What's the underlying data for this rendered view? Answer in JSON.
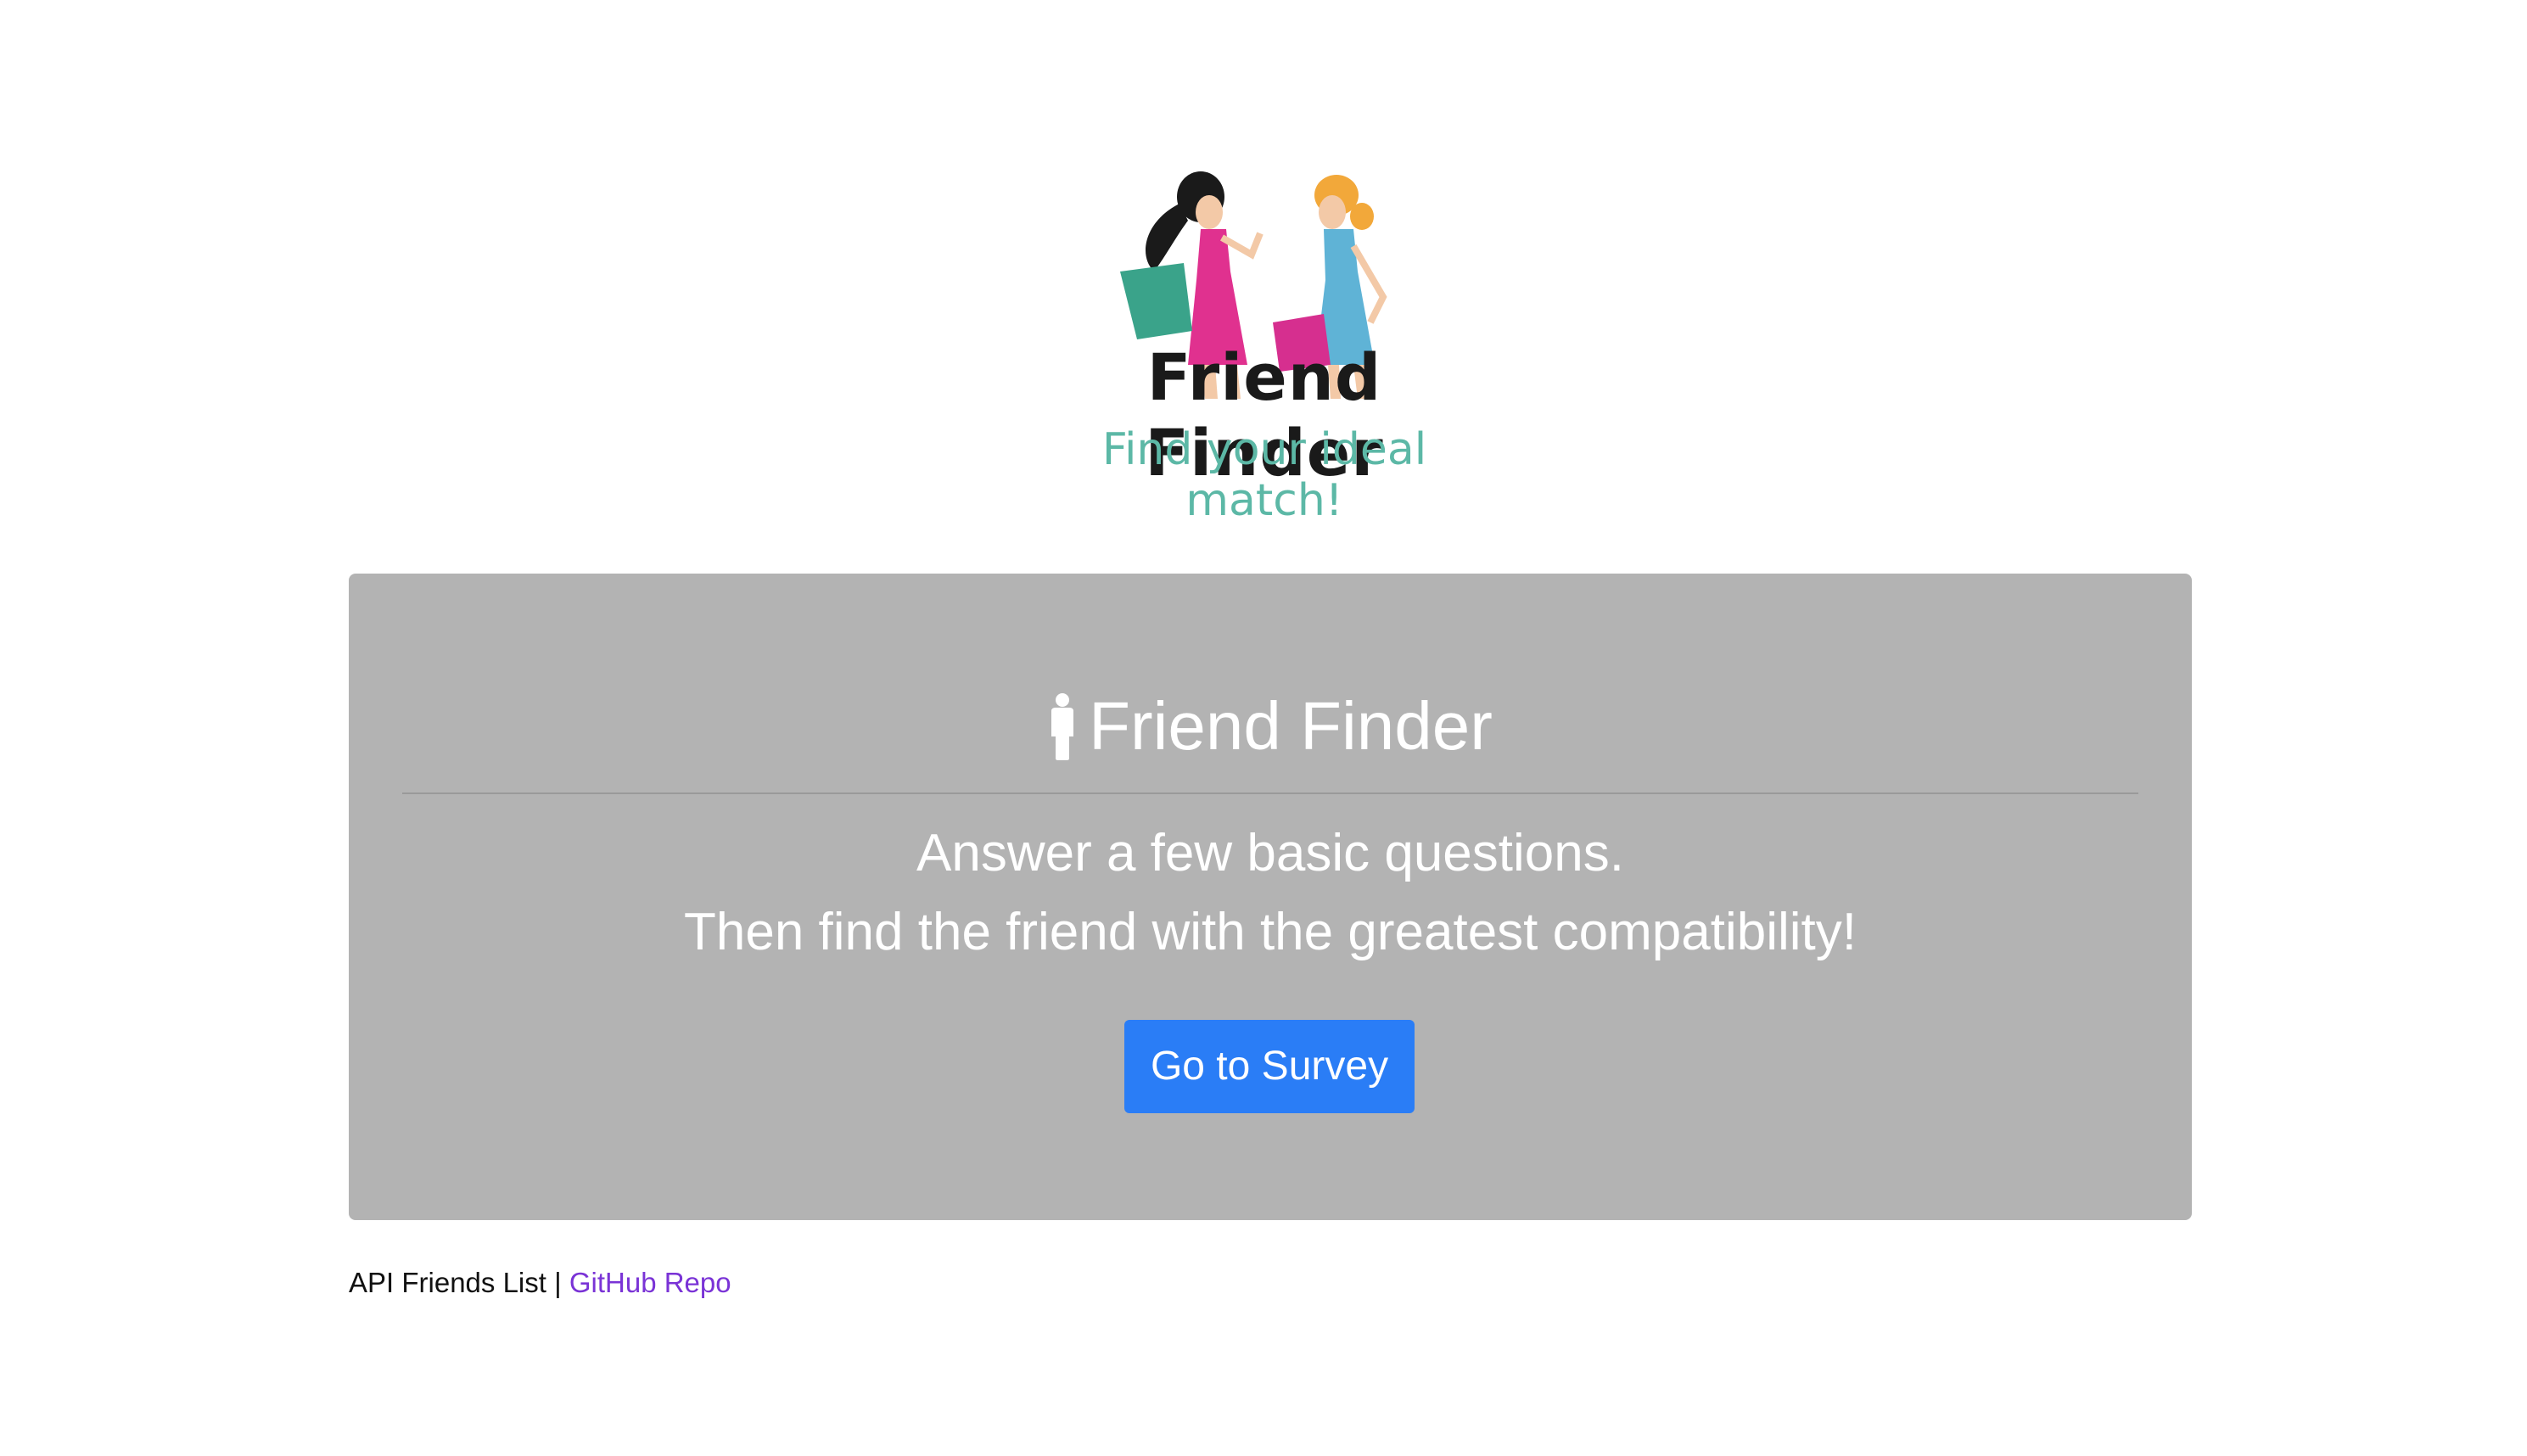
{
  "logo": {
    "title": "Friend Finder",
    "tagline": "Find your ideal match!"
  },
  "jumbotron": {
    "icon": "person-icon",
    "heading": "Friend Finder",
    "lead_line_1": "Answer a few basic questions.",
    "lead_line_2": "Then find the friend with the greatest compatibility!",
    "button_label": "Go to Survey",
    "background_color": "#b3b3b3",
    "button_color": "#2a7df6"
  },
  "footer": {
    "api_link": "API Friends List",
    "separator": "|",
    "repo_link": "GitHub Repo",
    "link_color": "#7a33d6"
  }
}
